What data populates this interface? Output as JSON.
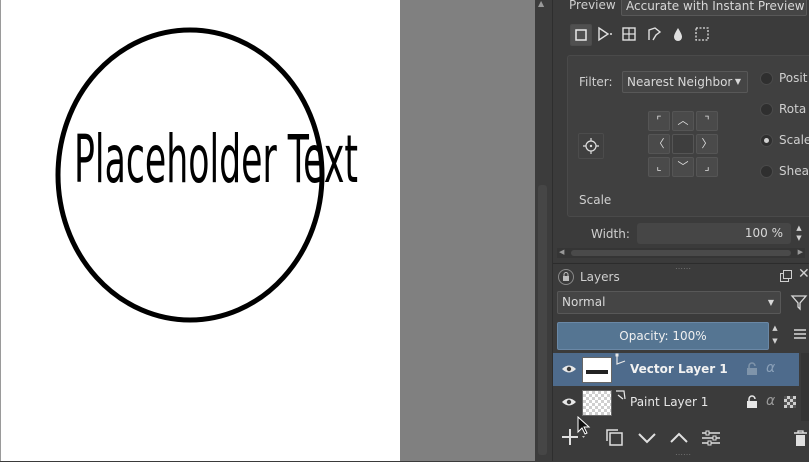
{
  "canvas": {
    "placeholder_text": "Placeholder Text"
  },
  "tool_options": {
    "preview_label": "Preview",
    "preview_mode": "Accurate with Instant Preview",
    "filter_label": "Filter:",
    "filter_value": "Nearest Neighbor",
    "transform_modes": [
      "Posit",
      "Rota",
      "Scale",
      "Shea"
    ],
    "selected_mode": "Scale",
    "scale_section": "Scale",
    "width_label": "Width:",
    "width_value": "100 %"
  },
  "layers": {
    "title": "Layers",
    "blend_mode": "Normal",
    "opacity_label": "Opacity:  100%",
    "items": [
      {
        "name": "Vector Layer 1",
        "selected": true
      },
      {
        "name": "Paint Layer 1",
        "selected": false
      }
    ]
  },
  "colors": {
    "panel_bg": "#3b3b3b",
    "selection": "#4e6b8c",
    "canvas_bg": "#ffffff",
    "outside_canvas": "#808080"
  }
}
